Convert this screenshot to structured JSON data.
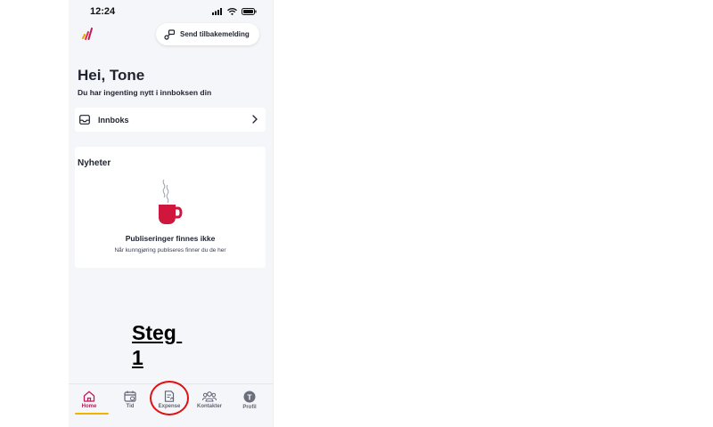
{
  "status_bar": {
    "time": "12:24"
  },
  "header": {
    "feedback_button": "Send tilbakemelding"
  },
  "greeting": {
    "title": "Hei, Tone",
    "subtitle": "Du har ingenting nytt i innboksen din"
  },
  "inbox": {
    "label": "Innboks"
  },
  "news": {
    "title": "Nyheter",
    "empty_title": "Publiseringer finnes ikke",
    "empty_text": "Når kunngjøring publiseres finner du de her"
  },
  "annotation": {
    "text": "Steg \n1"
  },
  "bottom_nav": {
    "items": [
      {
        "label": "Home",
        "icon": "home-icon",
        "active": true
      },
      {
        "label": "Tid",
        "icon": "calendar-icon",
        "active": false
      },
      {
        "label": "Expense",
        "icon": "receipt-icon",
        "active": false
      },
      {
        "label": "Kontakter",
        "icon": "contacts-icon",
        "active": false
      },
      {
        "label": "Profil",
        "icon": "avatar-icon",
        "active": false
      }
    ],
    "profile_initial": "T"
  },
  "colors": {
    "accent": "#c3185a",
    "mug": "#d0163d",
    "highlight_bar": "#f0b400",
    "annotation_circle": "#e01010",
    "background": "#f5f6f9"
  }
}
